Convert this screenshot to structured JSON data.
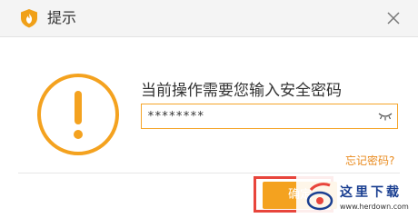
{
  "window": {
    "title": "提示",
    "logo_icon": "flame-shield-icon",
    "close_icon": "close-icon"
  },
  "dialog": {
    "alert_icon": "exclamation-circle-icon",
    "prompt": "当前操作需要您输入安全密码",
    "password_value": "********",
    "eye_icon": "eye-closed-icon",
    "forgot_link": "忘记密码?",
    "confirm_label": "确定"
  },
  "watermark": {
    "text": "这里下载",
    "url": "www.herdown.com"
  },
  "colors": {
    "accent": "#f4a21f",
    "link": "#e98b1f",
    "highlight": "#e8453c",
    "titlebar_bg": "#f4f4f4",
    "watermark_text": "#1a3f91"
  }
}
